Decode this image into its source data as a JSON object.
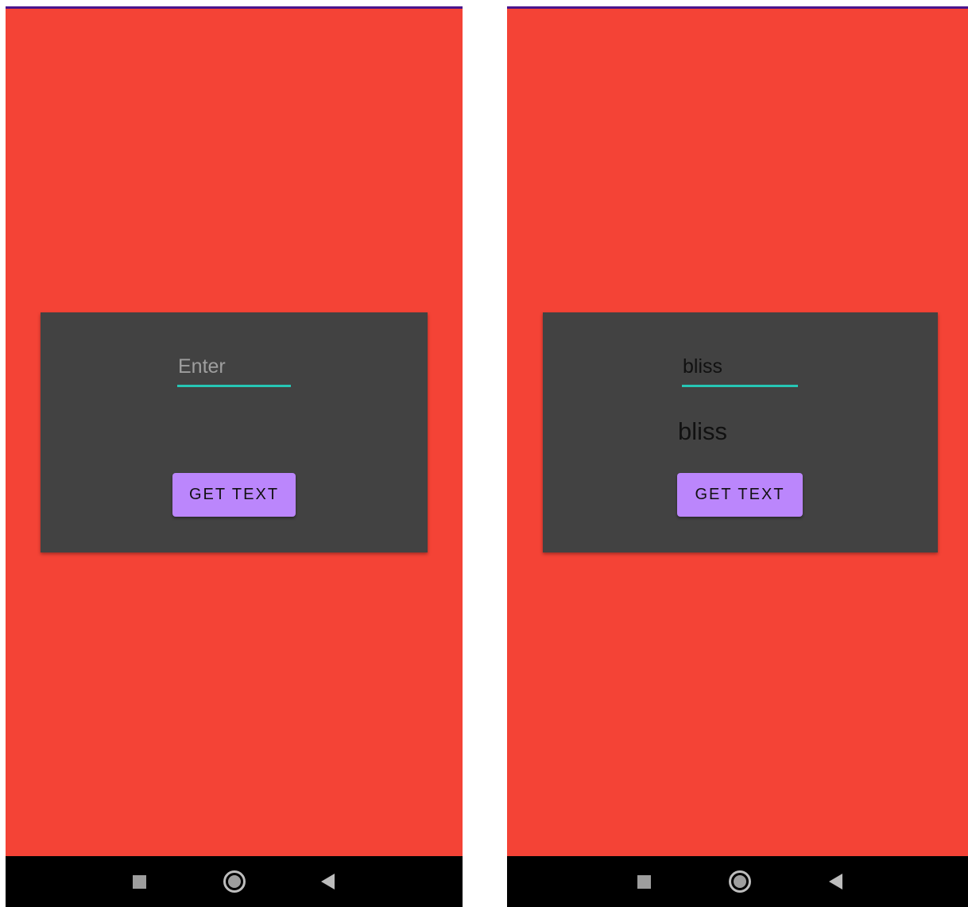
{
  "screens": [
    {
      "input": {
        "value": "",
        "placeholder": "Enter"
      },
      "result_text": "",
      "button_label": "GET TEXT"
    },
    {
      "input": {
        "value": "bliss",
        "placeholder": "Enter"
      },
      "result_text": "bliss",
      "button_label": "GET TEXT"
    }
  ],
  "navigation": {
    "icons": [
      "recents-icon",
      "home-icon",
      "back-icon"
    ]
  },
  "colors": {
    "background": "#f44336",
    "card": "#424242",
    "accent_underline": "#26c6b5",
    "button": "#bb86fc",
    "status_strip": "#4a148c",
    "nav_bar": "#000000"
  }
}
